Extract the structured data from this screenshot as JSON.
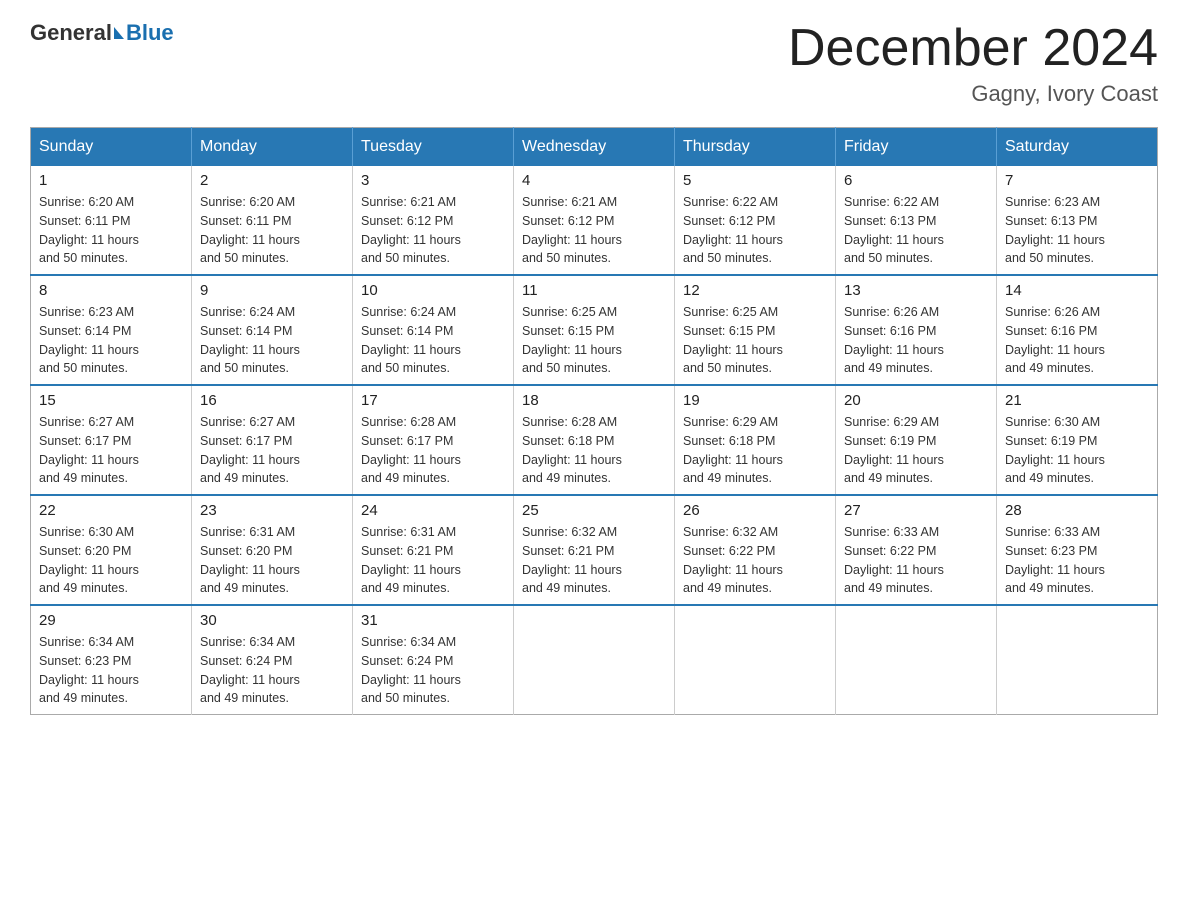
{
  "header": {
    "logo_general": "General",
    "logo_blue": "Blue",
    "month_title": "December 2024",
    "location": "Gagny, Ivory Coast"
  },
  "days_of_week": [
    "Sunday",
    "Monday",
    "Tuesday",
    "Wednesday",
    "Thursday",
    "Friday",
    "Saturday"
  ],
  "weeks": [
    [
      {
        "day": "1",
        "sunrise": "6:20 AM",
        "sunset": "6:11 PM",
        "daylight": "11 hours and 50 minutes."
      },
      {
        "day": "2",
        "sunrise": "6:20 AM",
        "sunset": "6:11 PM",
        "daylight": "11 hours and 50 minutes."
      },
      {
        "day": "3",
        "sunrise": "6:21 AM",
        "sunset": "6:12 PM",
        "daylight": "11 hours and 50 minutes."
      },
      {
        "day": "4",
        "sunrise": "6:21 AM",
        "sunset": "6:12 PM",
        "daylight": "11 hours and 50 minutes."
      },
      {
        "day": "5",
        "sunrise": "6:22 AM",
        "sunset": "6:12 PM",
        "daylight": "11 hours and 50 minutes."
      },
      {
        "day": "6",
        "sunrise": "6:22 AM",
        "sunset": "6:13 PM",
        "daylight": "11 hours and 50 minutes."
      },
      {
        "day": "7",
        "sunrise": "6:23 AM",
        "sunset": "6:13 PM",
        "daylight": "11 hours and 50 minutes."
      }
    ],
    [
      {
        "day": "8",
        "sunrise": "6:23 AM",
        "sunset": "6:14 PM",
        "daylight": "11 hours and 50 minutes."
      },
      {
        "day": "9",
        "sunrise": "6:24 AM",
        "sunset": "6:14 PM",
        "daylight": "11 hours and 50 minutes."
      },
      {
        "day": "10",
        "sunrise": "6:24 AM",
        "sunset": "6:14 PM",
        "daylight": "11 hours and 50 minutes."
      },
      {
        "day": "11",
        "sunrise": "6:25 AM",
        "sunset": "6:15 PM",
        "daylight": "11 hours and 50 minutes."
      },
      {
        "day": "12",
        "sunrise": "6:25 AM",
        "sunset": "6:15 PM",
        "daylight": "11 hours and 50 minutes."
      },
      {
        "day": "13",
        "sunrise": "6:26 AM",
        "sunset": "6:16 PM",
        "daylight": "11 hours and 49 minutes."
      },
      {
        "day": "14",
        "sunrise": "6:26 AM",
        "sunset": "6:16 PM",
        "daylight": "11 hours and 49 minutes."
      }
    ],
    [
      {
        "day": "15",
        "sunrise": "6:27 AM",
        "sunset": "6:17 PM",
        "daylight": "11 hours and 49 minutes."
      },
      {
        "day": "16",
        "sunrise": "6:27 AM",
        "sunset": "6:17 PM",
        "daylight": "11 hours and 49 minutes."
      },
      {
        "day": "17",
        "sunrise": "6:28 AM",
        "sunset": "6:17 PM",
        "daylight": "11 hours and 49 minutes."
      },
      {
        "day": "18",
        "sunrise": "6:28 AM",
        "sunset": "6:18 PM",
        "daylight": "11 hours and 49 minutes."
      },
      {
        "day": "19",
        "sunrise": "6:29 AM",
        "sunset": "6:18 PM",
        "daylight": "11 hours and 49 minutes."
      },
      {
        "day": "20",
        "sunrise": "6:29 AM",
        "sunset": "6:19 PM",
        "daylight": "11 hours and 49 minutes."
      },
      {
        "day": "21",
        "sunrise": "6:30 AM",
        "sunset": "6:19 PM",
        "daylight": "11 hours and 49 minutes."
      }
    ],
    [
      {
        "day": "22",
        "sunrise": "6:30 AM",
        "sunset": "6:20 PM",
        "daylight": "11 hours and 49 minutes."
      },
      {
        "day": "23",
        "sunrise": "6:31 AM",
        "sunset": "6:20 PM",
        "daylight": "11 hours and 49 minutes."
      },
      {
        "day": "24",
        "sunrise": "6:31 AM",
        "sunset": "6:21 PM",
        "daylight": "11 hours and 49 minutes."
      },
      {
        "day": "25",
        "sunrise": "6:32 AM",
        "sunset": "6:21 PM",
        "daylight": "11 hours and 49 minutes."
      },
      {
        "day": "26",
        "sunrise": "6:32 AM",
        "sunset": "6:22 PM",
        "daylight": "11 hours and 49 minutes."
      },
      {
        "day": "27",
        "sunrise": "6:33 AM",
        "sunset": "6:22 PM",
        "daylight": "11 hours and 49 minutes."
      },
      {
        "day": "28",
        "sunrise": "6:33 AM",
        "sunset": "6:23 PM",
        "daylight": "11 hours and 49 minutes."
      }
    ],
    [
      {
        "day": "29",
        "sunrise": "6:34 AM",
        "sunset": "6:23 PM",
        "daylight": "11 hours and 49 minutes."
      },
      {
        "day": "30",
        "sunrise": "6:34 AM",
        "sunset": "6:24 PM",
        "daylight": "11 hours and 49 minutes."
      },
      {
        "day": "31",
        "sunrise": "6:34 AM",
        "sunset": "6:24 PM",
        "daylight": "11 hours and 50 minutes."
      },
      null,
      null,
      null,
      null
    ]
  ]
}
